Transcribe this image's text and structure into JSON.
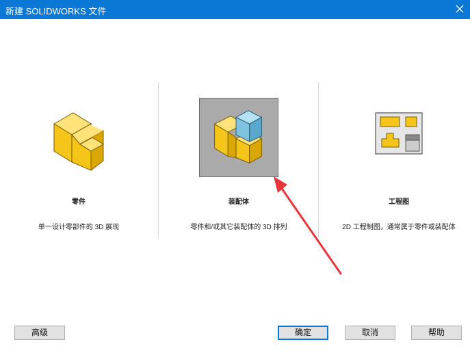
{
  "window": {
    "title": "新建 SOLIDWORKS 文件"
  },
  "options": [
    {
      "label": "零件",
      "description": "单一设计零部件的 3D 展现",
      "icon": "part-icon",
      "selected": false
    },
    {
      "label": "装配体",
      "description": "零件和/或其它装配体的 3D 排列",
      "icon": "assembly-icon",
      "selected": true
    },
    {
      "label": "工程图",
      "description": "2D 工程制图，通常属于零件或装配体",
      "icon": "drawing-icon",
      "selected": false
    }
  ],
  "buttons": {
    "advanced": "高级",
    "ok": "确定",
    "cancel": "取消",
    "help": "帮助"
  },
  "colors": {
    "titlebar": "#0a78d4",
    "part_yellow": "#f5c518",
    "assembly_blue": "#7fc3e0",
    "annotation_arrow": "#e8353a"
  }
}
